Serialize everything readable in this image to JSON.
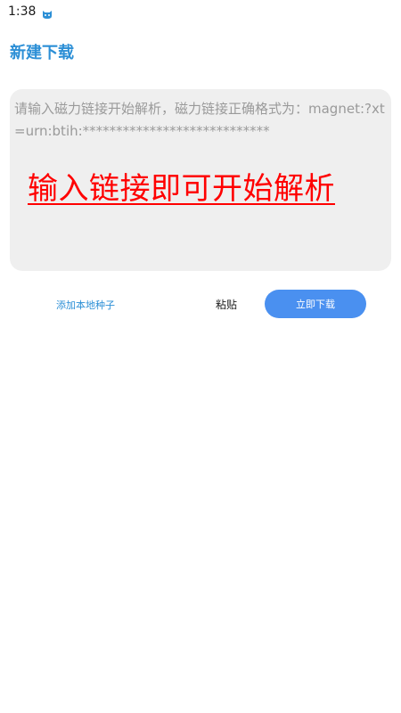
{
  "status_bar": {
    "time": "1:38",
    "notification_icon": "cat-face-icon"
  },
  "header": {
    "title": "新建下载"
  },
  "magnet_input": {
    "placeholder": "请输入磁力链接开始解析，磁力链接正确格式为：magnet:?xt=urn:btih:****************************",
    "value": ""
  },
  "overlay": {
    "text": "输入链接即可开始解析"
  },
  "actions": {
    "add_local_seed": "添加本地种子",
    "paste": "粘贴",
    "download_now": "立即下载"
  },
  "colors": {
    "accent": "#2c8fd6",
    "button_blue": "#4a90f0",
    "overlay_red": "#ff0000",
    "card_bg": "#efefef"
  }
}
